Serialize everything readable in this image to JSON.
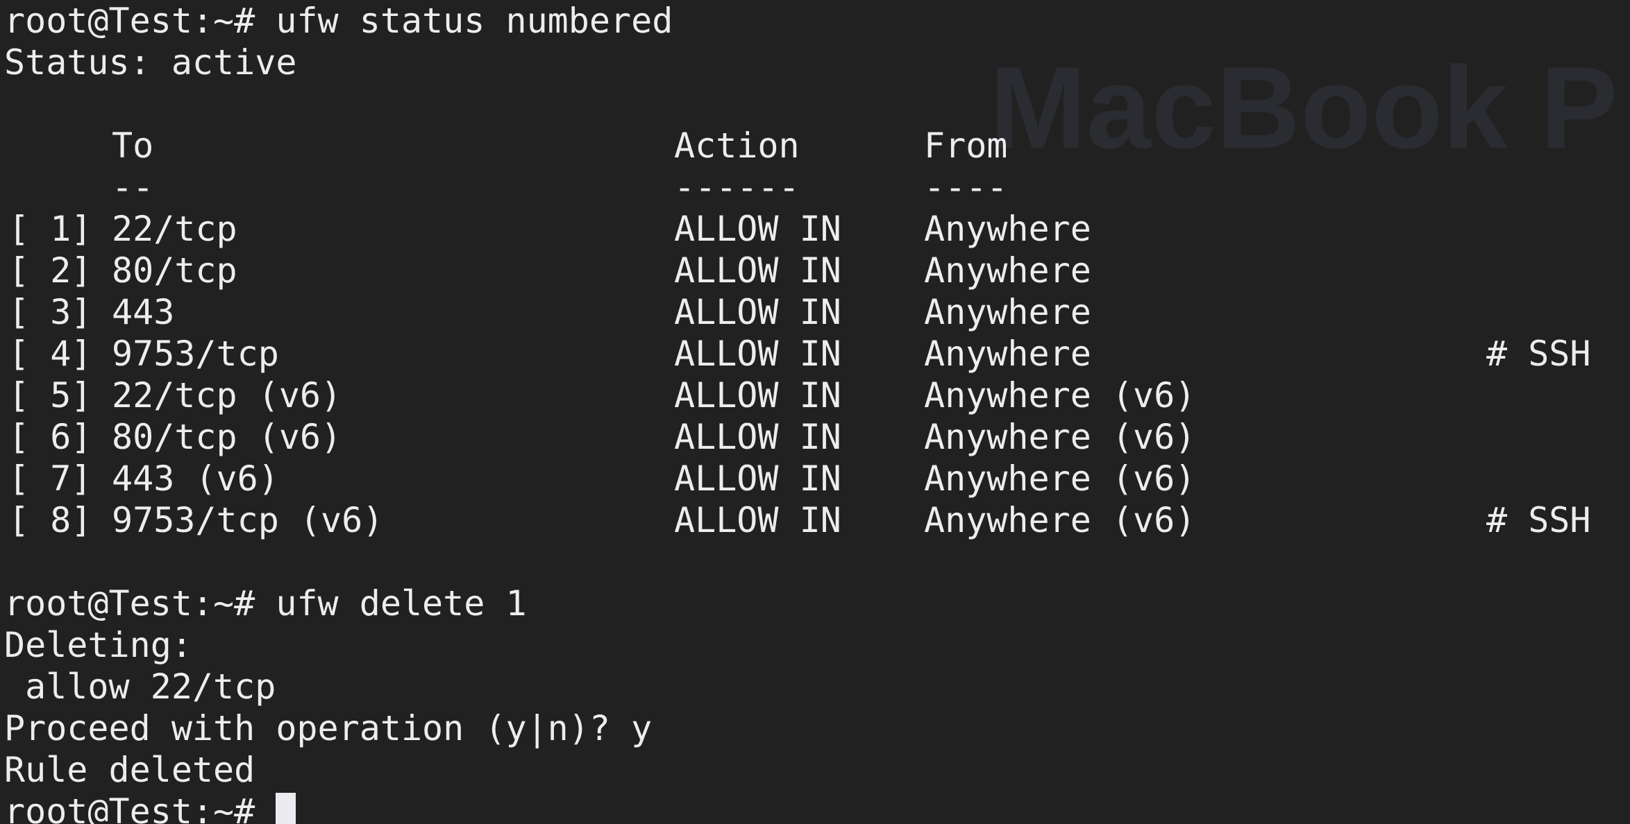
{
  "watermark": "MacBook P",
  "prompt": "root@Test:~#",
  "lines": {
    "cmd1": "ufw status numbered",
    "status": "Status: active",
    "cmd2": "ufw delete 1",
    "deleting": "Deleting:",
    "deleting_rule": " allow 22/tcp",
    "proceed": "Proceed with operation (y|n)? y",
    "result": "Rule deleted"
  },
  "table": {
    "headers": {
      "to": "To",
      "action": "Action",
      "from": "From"
    },
    "underlines": {
      "to": "--",
      "action": "------",
      "from": "----"
    },
    "rows": [
      {
        "num": "[ 1]",
        "to": "22/tcp",
        "action": "ALLOW IN",
        "from": "Anywhere",
        "comment": ""
      },
      {
        "num": "[ 2]",
        "to": "80/tcp",
        "action": "ALLOW IN",
        "from": "Anywhere",
        "comment": ""
      },
      {
        "num": "[ 3]",
        "to": "443",
        "action": "ALLOW IN",
        "from": "Anywhere",
        "comment": ""
      },
      {
        "num": "[ 4]",
        "to": "9753/tcp",
        "action": "ALLOW IN",
        "from": "Anywhere",
        "comment": "# SSH"
      },
      {
        "num": "[ 5]",
        "to": "22/tcp (v6)",
        "action": "ALLOW IN",
        "from": "Anywhere (v6)",
        "comment": ""
      },
      {
        "num": "[ 6]",
        "to": "80/tcp (v6)",
        "action": "ALLOW IN",
        "from": "Anywhere (v6)",
        "comment": ""
      },
      {
        "num": "[ 7]",
        "to": "443 (v6)",
        "action": "ALLOW IN",
        "from": "Anywhere (v6)",
        "comment": ""
      },
      {
        "num": "[ 8]",
        "to": "9753/tcp (v6)",
        "action": "ALLOW IN",
        "from": "Anywhere (v6)",
        "comment": "# SSH"
      }
    ]
  }
}
